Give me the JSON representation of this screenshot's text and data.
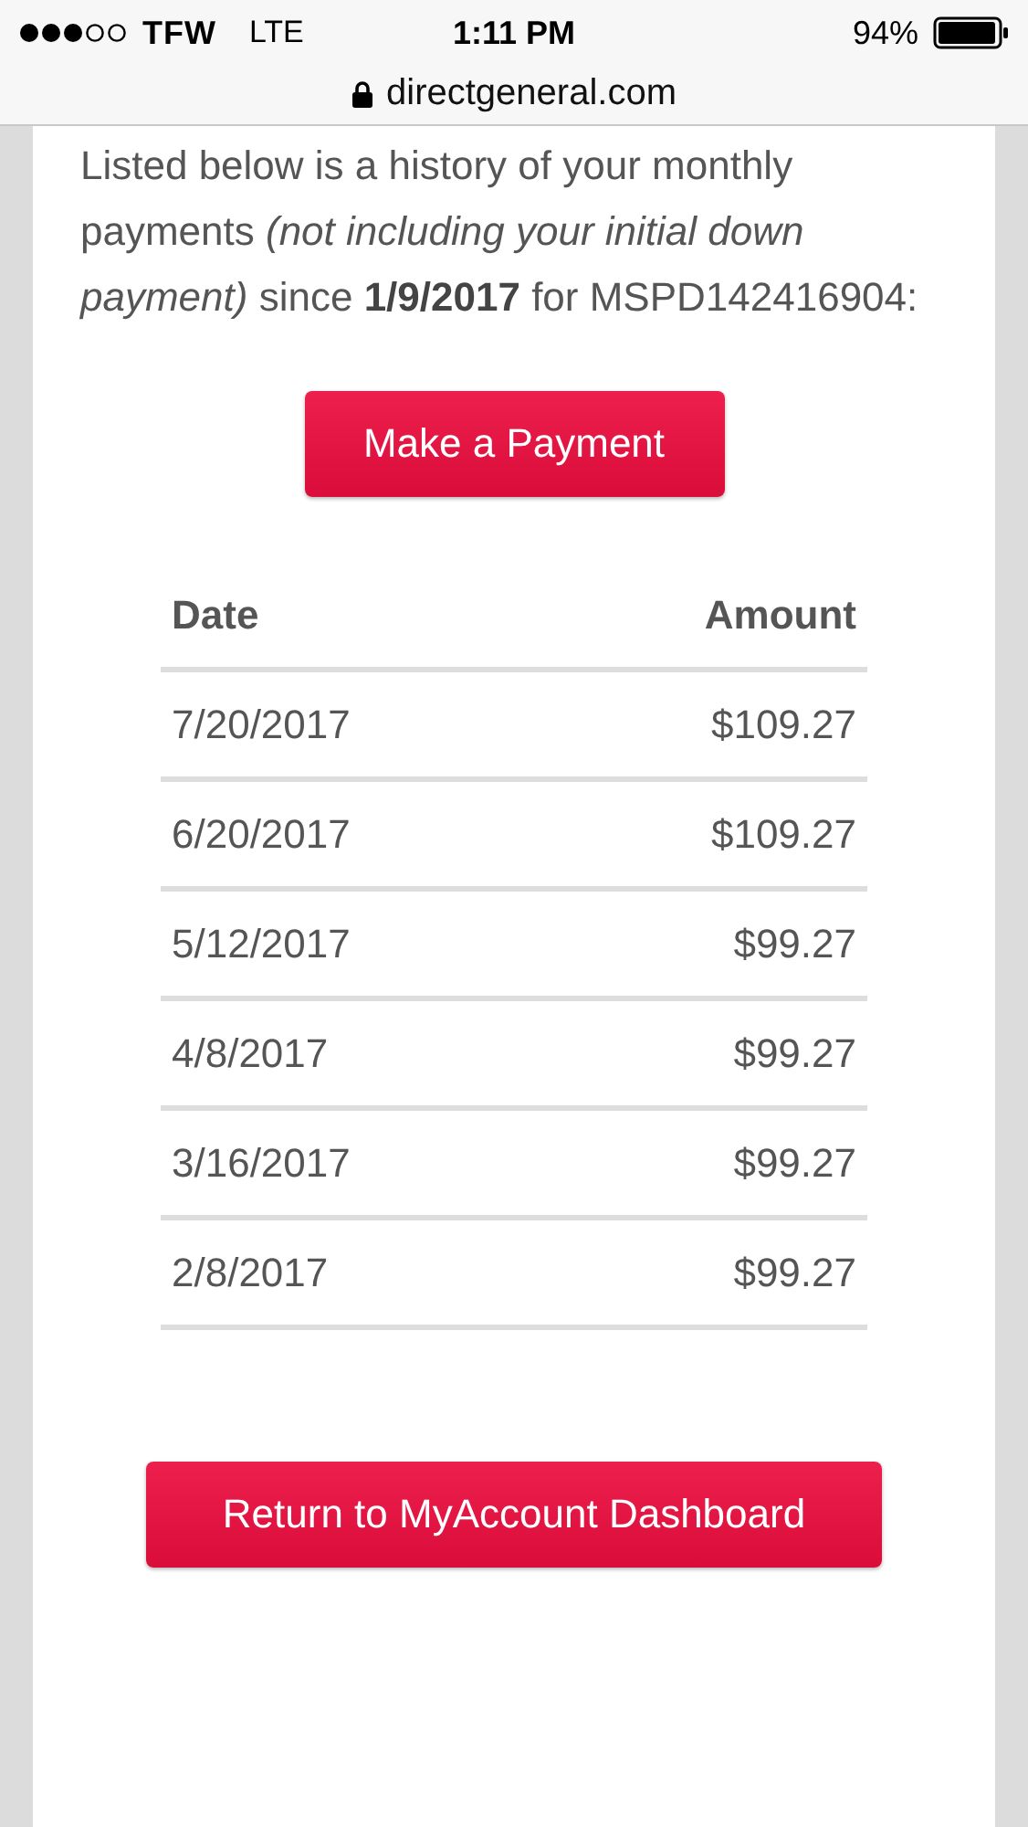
{
  "status_bar": {
    "carrier": "TFW",
    "network": "LTE",
    "time": "1:11 PM",
    "battery": "94%"
  },
  "address_bar": {
    "url": "directgeneral.com"
  },
  "intro": "Listed below is a history of your monthly payments *(not including your initial down payment)* since **1/9/2017** for MSPD142416904:",
  "primary_button": "Make a Payment",
  "table": {
    "columns": [
      "Date",
      "Amount"
    ],
    "rows": [
      {
        "date": "7/20/2017",
        "amount": "$109.27"
      },
      {
        "date": "6/20/2017",
        "amount": "$109.27"
      },
      {
        "date": "5/12/2017",
        "amount": "$99.27"
      },
      {
        "date": "4/8/2017",
        "amount": "$99.27"
      },
      {
        "date": "3/16/2017",
        "amount": "$99.27"
      },
      {
        "date": "2/8/2017",
        "amount": "$99.27"
      }
    ]
  },
  "return_button": "Return to MyAccount Dashboard"
}
